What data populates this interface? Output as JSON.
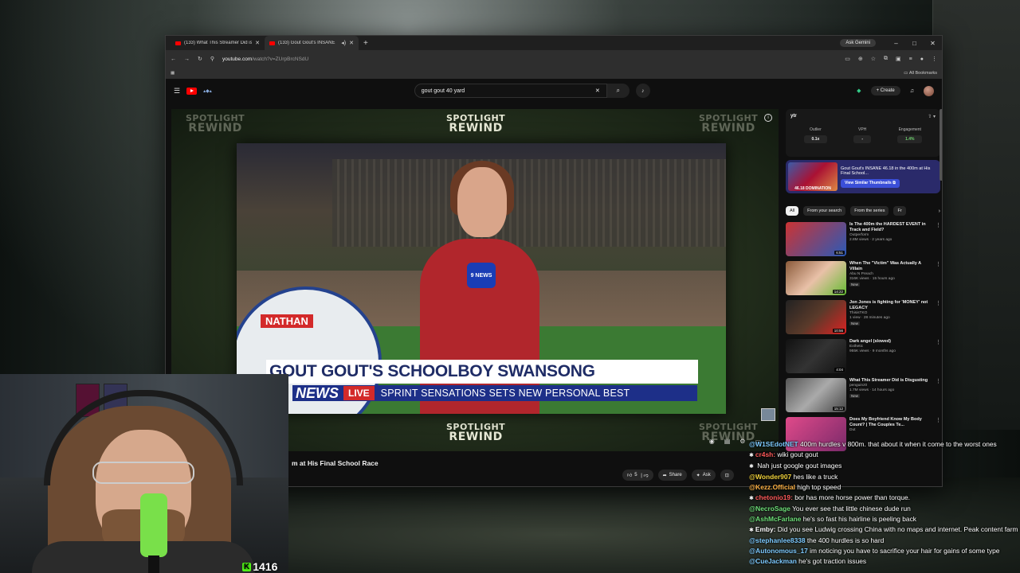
{
  "browser": {
    "tabs": [
      {
        "label": "(133) What This Streamer Did is",
        "active": false
      },
      {
        "label": "(133) Gout Gout's INSANE",
        "active": true
      }
    ],
    "ask_gemini": "Ask Gemini",
    "url_host": "youtube.com",
    "url_path": "/watch?v=ZUrpBrcNSdU",
    "bookmarks_label": "All Bookmarks"
  },
  "youtube": {
    "search_query": "gout gout 40 yard",
    "create_label": "Create"
  },
  "video": {
    "overlay_word1": "SPOTLIGHT",
    "overlay_word2": "REWIND",
    "name_tag": "NATHAN",
    "headline": "GOUT GOUT'S SCHOOLBOY SWANSONG",
    "channel_brand": "NEWS",
    "live": "LIVE",
    "ticker_text": "SPRINT SENSATIONS SETS NEW PERSONAL BEST",
    "mic_logo": "9 NEWS",
    "title_fragment": "m at His Final School Race",
    "likes": "5",
    "share_label": "Share",
    "ask_label": "Ask"
  },
  "extension": {
    "logo": "ytr",
    "outlier_label": "Outlier",
    "outlier_value": "0.1x",
    "vph_label": "VPH",
    "vph_value": "-",
    "engagement_label": "Engagement",
    "engagement_value": "1.4%",
    "similar_title": "Gout Gout's INSANE 46.18 in the 400m at His Final School...",
    "similar_button": "View Similar Thumbnails",
    "similar_thumb_text": "46.18 DOMINATION"
  },
  "chips": [
    "All",
    "From your search",
    "From the series",
    "Fr"
  ],
  "recommendations": [
    {
      "title": "Is The 400m the HARDEST EVENT in Track and Field?",
      "channel": "Outperform",
      "meta": "2.8M views · 2 years ago",
      "duration": "6:51",
      "new": ""
    },
    {
      "title": "When The \"Victim\" Was Actually A Villain",
      "channel": "Abu N Preach",
      "meta": "316K views · 15 hours ago",
      "duration": "14:22",
      "new": "New"
    },
    {
      "title": "Jon Jones is fighting for 'MONEY' not LEGACY",
      "channel": "ThisisTKO",
      "meta": "1 view · 28 minutes ago",
      "duration": "10:56",
      "new": "New"
    },
    {
      "title": "Dark angel (slowed)",
      "channel": "Exthetic",
      "meta": "955K views · 9 months ago",
      "duration": "4:04",
      "new": ""
    },
    {
      "title": "What This Streamer Did is Disgusting",
      "channel": "penguinz0",
      "meta": "1.7M views · 14 hours ago",
      "duration": "15:12",
      "new": "New"
    },
    {
      "title": "Does My Boyfriend Know My Body Count? | The Couples Te...",
      "channel": "Dut",
      "meta": "",
      "duration": "",
      "new": ""
    }
  ],
  "stream": {
    "viewer_count": "1416",
    "kick_logo": "K"
  },
  "chat": [
    {
      "user": "@W1SEdotNET",
      "color": "#7ecbff",
      "text": " 400m hurdles v 800m. that about it when it come to the worst ones",
      "badge": ""
    },
    {
      "user": "cr4sh:",
      "color": "#ff5a5a",
      "text": " wiki gout gout",
      "badge": "✱"
    },
    {
      "user": "",
      "color": "#7a6cff",
      "text": " Nah just google gout images",
      "badge": "✱"
    },
    {
      "user": "@Wonder907",
      "color": "#f2d33c",
      "text": " hes like a truck",
      "badge": ""
    },
    {
      "user": "@Kezz.Official",
      "color": "#ffb347",
      "text": " high top speed",
      "badge": ""
    },
    {
      "user": "chetonio19:",
      "color": "#ff5a5a",
      "text": " bor has more horse power than torque.",
      "badge": "✱"
    },
    {
      "user": "@NecroSage",
      "color": "#6fe07a",
      "text": " You ever see that little chinese dude run",
      "badge": ""
    },
    {
      "user": "@AshMcFarlane",
      "color": "#6fe07a",
      "text": " he's so fast his hairline is peeling back",
      "badge": ""
    },
    {
      "user": "Emby:",
      "color": "#ffffff",
      "text": " Did you see Ludwig crossing China with no maps and internet. Peak content farm",
      "badge": "✱"
    },
    {
      "user": "@stephanlee8338",
      "color": "#7ecbff",
      "text": " the 400 hurdles is so hard",
      "badge": ""
    },
    {
      "user": "@Autonomous_17",
      "color": "#7ecbff",
      "text": " im noticing you have to sacrifice your hair for gains of some type",
      "badge": ""
    },
    {
      "user": "@CueJackman",
      "color": "#7ecbff",
      "text": " he's got traction issues",
      "badge": ""
    }
  ]
}
